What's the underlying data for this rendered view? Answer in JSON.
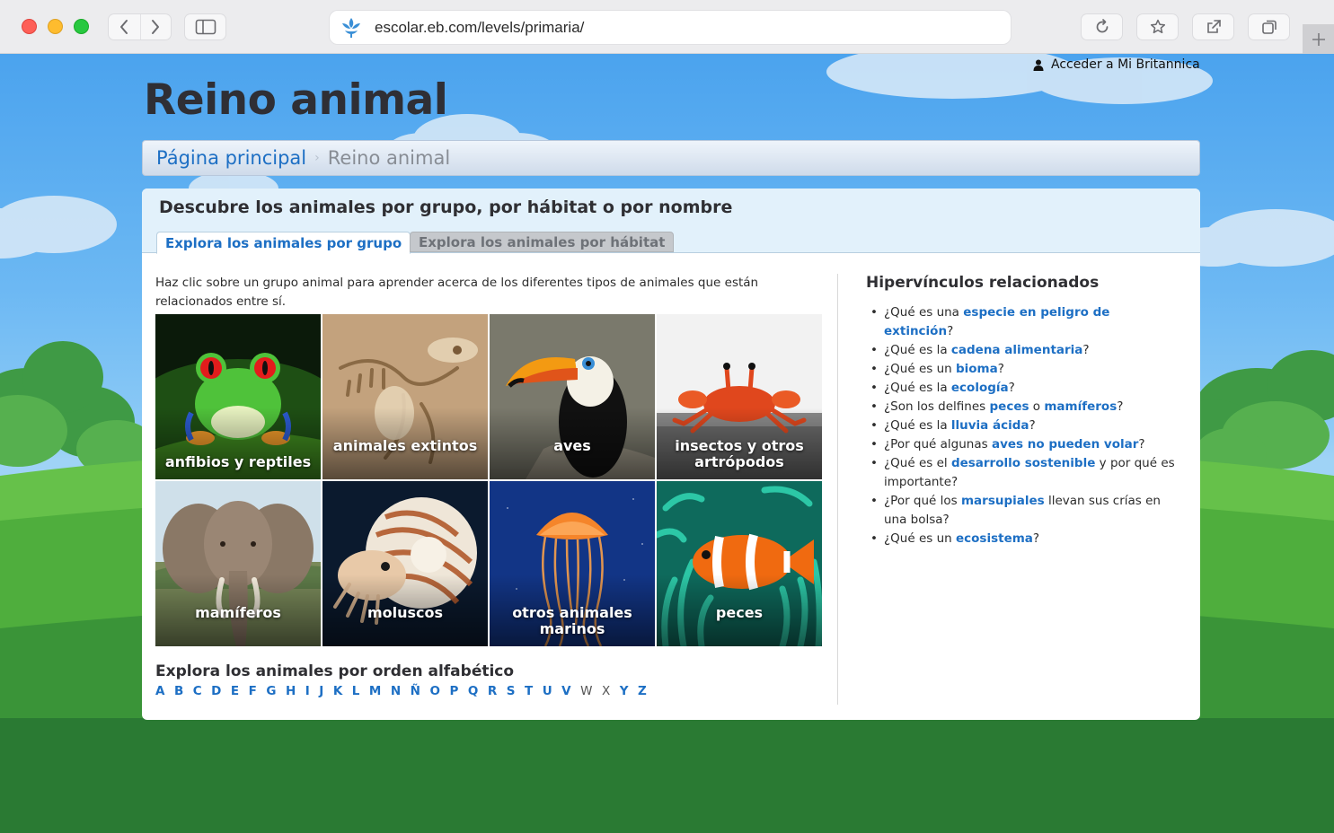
{
  "browser": {
    "url": "escolar.eb.com/levels/primaria/"
  },
  "account": {
    "label": "Acceder a Mi Britannica"
  },
  "page": {
    "title": "Reino animal"
  },
  "breadcrumb": {
    "home": "Página principal",
    "separator": "›",
    "current": "Reino animal"
  },
  "panel": {
    "title": "Descubre los animales por grupo, por hábitat o por nombre",
    "tabs": [
      {
        "label": "Explora los animales por grupo",
        "active": true
      },
      {
        "label": "Explora los animales por hábitat",
        "active": false
      }
    ],
    "intro": "Haz clic sobre un grupo animal para aprender acerca de los diferentes tipos de animales que están relacionados entre sí."
  },
  "groups": [
    {
      "label": "anfibios y reptiles",
      "image": "frog"
    },
    {
      "label": "animales extintos",
      "image": "fossil"
    },
    {
      "label": "aves",
      "image": "toucan"
    },
    {
      "label": "insectos y otros artrópodos",
      "image": "crab"
    },
    {
      "label": "mamíferos",
      "image": "elephant"
    },
    {
      "label": "moluscos",
      "image": "nautilus"
    },
    {
      "label": "otros animales marinos",
      "image": "jellyfish"
    },
    {
      "label": "peces",
      "image": "clownfish"
    }
  ],
  "alphabet": {
    "title": "Explora los animales por orden alfabético",
    "letters": [
      "A",
      "B",
      "C",
      "D",
      "E",
      "F",
      "G",
      "H",
      "I",
      "J",
      "K",
      "L",
      "M",
      "N",
      "Ñ",
      "O",
      "P",
      "Q",
      "R",
      "S",
      "T",
      "U",
      "V",
      "W",
      "X",
      "Y",
      "Z"
    ],
    "disabled": [
      "W",
      "X"
    ]
  },
  "related": {
    "title": "Hipervínculos relacionados",
    "items": [
      {
        "pre": "¿Qué es una ",
        "link": "especie en peligro de extinción",
        "post": "?"
      },
      {
        "pre": "¿Qué es la ",
        "link": "cadena alimentaria",
        "post": "?"
      },
      {
        "pre": "¿Qué es un ",
        "link": "bioma",
        "post": "?"
      },
      {
        "pre": "¿Qué es la ",
        "link": "ecología",
        "post": "?"
      },
      {
        "pre": "¿Son los delfines ",
        "link": "peces",
        "mid": " o ",
        "link2": "mamíferos",
        "post": "?"
      },
      {
        "pre": "¿Qué es la ",
        "link": "lluvia ácida",
        "post": "?"
      },
      {
        "pre": "¿Por qué algunas ",
        "link": "aves no pueden volar",
        "post": "?"
      },
      {
        "pre": "¿Qué es el ",
        "link": "desarrollo sostenible",
        "post": " y por qué es importante?"
      },
      {
        "pre": "¿Por qué los ",
        "link": "marsupiales",
        "post": " llevan sus crías en una bolsa?"
      },
      {
        "pre": "¿Qué es un ",
        "link": "ecosistema",
        "post": "?"
      }
    ]
  },
  "colors": {
    "link": "#1d6fc4",
    "sky": "#5aaef0",
    "grass": "#2f8a3a"
  },
  "icons": [
    "chevron-left-icon",
    "chevron-right-icon",
    "sidebar-icon",
    "britannica-logo-icon",
    "reload-icon",
    "star-icon",
    "share-icon",
    "tabs-icon",
    "plus-icon",
    "user-icon"
  ]
}
